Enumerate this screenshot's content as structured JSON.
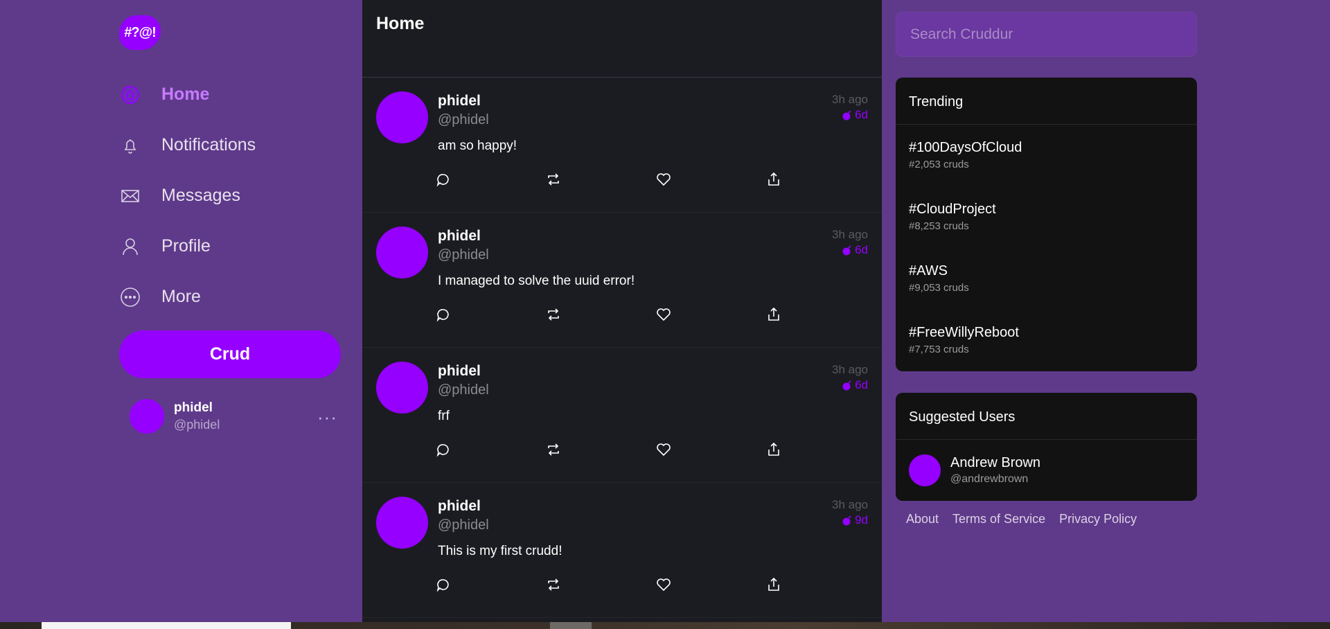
{
  "app": {
    "logo_text": "#?@!",
    "brand_color": "#9500ff",
    "background_color": "#5f3a8a"
  },
  "nav": {
    "items": [
      {
        "label": "Home",
        "icon": "home-icon",
        "active": true
      },
      {
        "label": "Notifications",
        "icon": "bell-icon"
      },
      {
        "label": "Messages",
        "icon": "envelope-icon"
      },
      {
        "label": "Profile",
        "icon": "user-icon"
      },
      {
        "label": "More",
        "icon": "more-circle-icon"
      }
    ],
    "crud_button": "Crud"
  },
  "current_user": {
    "name": "phidel",
    "handle": "@phidel",
    "more": "···"
  },
  "feed": {
    "title": "Home",
    "activities": [
      {
        "name": "phidel",
        "handle": "@phidel",
        "message": "am so happy!",
        "time": "3h ago",
        "expires": "6d"
      },
      {
        "name": "phidel",
        "handle": "@phidel",
        "message": "I managed to solve the uuid error!",
        "time": "3h ago",
        "expires": "6d"
      },
      {
        "name": "phidel",
        "handle": "@phidel",
        "message": "frf",
        "time": "3h ago",
        "expires": "6d"
      },
      {
        "name": "phidel",
        "handle": "@phidel",
        "message": "This is my first crudd!",
        "time": "3h ago",
        "expires": "9d"
      }
    ]
  },
  "search": {
    "placeholder": "Search Cruddur"
  },
  "trending": {
    "title": "Trending",
    "items": [
      {
        "tag": "#100DaysOfCloud",
        "count": "#2,053 cruds"
      },
      {
        "tag": "#CloudProject",
        "count": "#8,253 cruds"
      },
      {
        "tag": "#AWS",
        "count": "#9,053 cruds"
      },
      {
        "tag": "#FreeWillyReboot",
        "count": "#7,753 cruds"
      }
    ]
  },
  "suggested": {
    "title": "Suggested Users",
    "users": [
      {
        "name": "Andrew Brown",
        "handle": "@andrewbrown"
      }
    ]
  },
  "footer": {
    "links": [
      "About",
      "Terms of Service",
      "Privacy Policy"
    ]
  }
}
